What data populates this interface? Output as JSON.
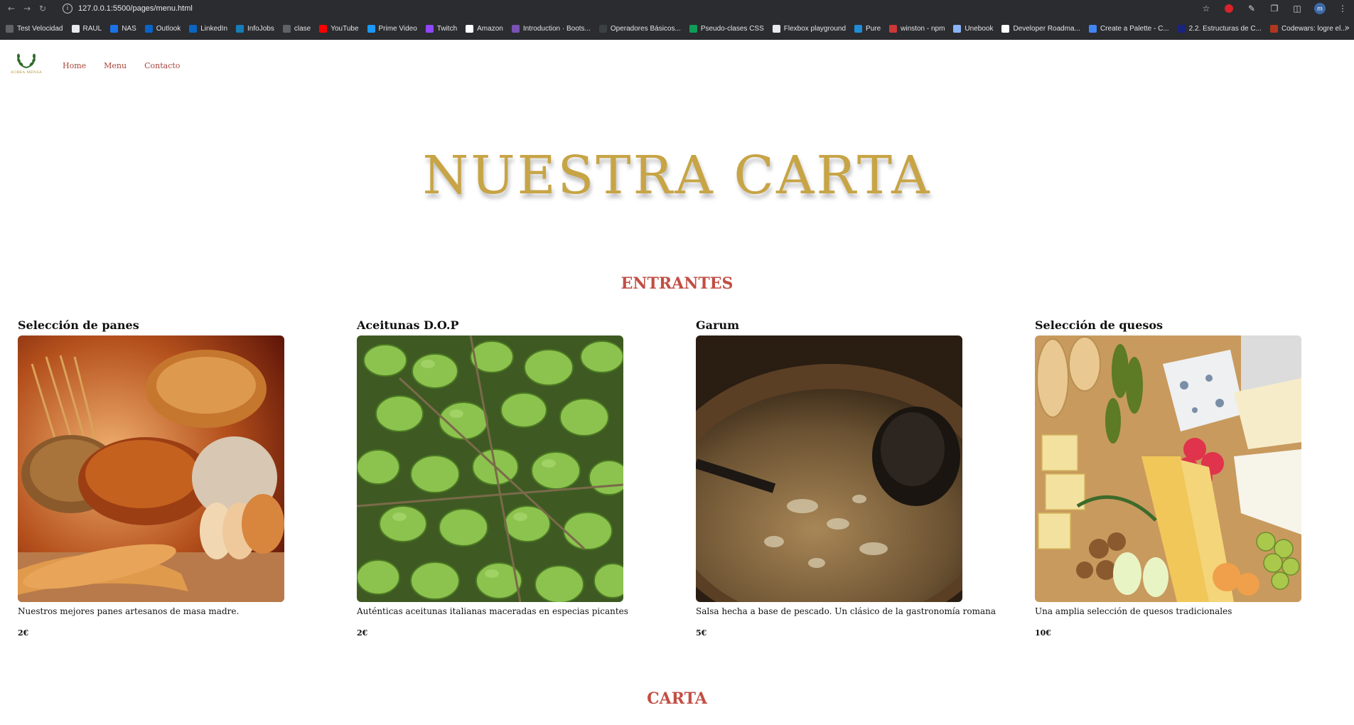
{
  "browser": {
    "url": "127.0.0.1:5500/pages/menu.html",
    "profile_initial": "m",
    "bookmarks": [
      {
        "label": "Test Velocidad",
        "icon": "speed-icon",
        "color": "#5f6368"
      },
      {
        "label": "RAUL",
        "icon": "page-icon",
        "color": "#e8eaed"
      },
      {
        "label": "NAS",
        "icon": "nas-icon",
        "color": "#1a73e8"
      },
      {
        "label": "Outlook",
        "icon": "outlook-icon",
        "color": "#0a64c9"
      },
      {
        "label": "LinkedIn",
        "icon": "linkedin-icon",
        "color": "#0a66c2"
      },
      {
        "label": "InfoJobs",
        "icon": "infojobs-icon",
        "color": "#167db7"
      },
      {
        "label": "clase",
        "icon": "clase-icon",
        "color": "#5f6368"
      },
      {
        "label": "YouTube",
        "icon": "youtube-icon",
        "color": "#ff0000"
      },
      {
        "label": "Prime Video",
        "icon": "prime-video-icon",
        "color": "#1a98ff"
      },
      {
        "label": "Twitch",
        "icon": "twitch-icon",
        "color": "#9146ff"
      },
      {
        "label": "Amazon",
        "icon": "amazon-icon",
        "color": "#ffffff"
      },
      {
        "label": "Introduction · Boots...",
        "icon": "bootstrap-icon",
        "color": "#7952b3"
      },
      {
        "label": "Operadores Básicos...",
        "icon": "operators-icon",
        "color": "#3c4043"
      },
      {
        "label": "Pseudo-clases CSS",
        "icon": "css-icon",
        "color": "#0f9d58"
      },
      {
        "label": "Flexbox playground",
        "icon": "flexbox-icon",
        "color": "#e8eaed"
      },
      {
        "label": "Pure",
        "icon": "pure-icon",
        "color": "#1f8dd6"
      },
      {
        "label": "winston - npm",
        "icon": "npm-icon",
        "color": "#cb3837"
      },
      {
        "label": "Unebook",
        "icon": "unebook-icon",
        "color": "#8ab4f8"
      },
      {
        "label": "Developer Roadma...",
        "icon": "roadmap-icon",
        "color": "#ffffff"
      },
      {
        "label": "Create a Palette - C...",
        "icon": "palette-icon",
        "color": "#4285f4"
      },
      {
        "label": "2.2. Estructuras de C...",
        "icon": "doc-icon",
        "color": "#1a237e"
      },
      {
        "label": "Codewars: logre el...",
        "icon": "codewars-icon",
        "color": "#b1361e"
      }
    ]
  },
  "site": {
    "logo_text": "AUREA MENSA",
    "nav": [
      {
        "label": "Home"
      },
      {
        "label": "Menu"
      },
      {
        "label": "Contacto"
      }
    ],
    "colors": {
      "gold": "#c7a445",
      "accent_red": "#c24e44",
      "nav_link": "#a8433a"
    }
  },
  "hero": {
    "title": "NUESTRA CARTA"
  },
  "sections": {
    "entrantes": "ENTRANTES",
    "carta": "CARTA"
  },
  "items": [
    {
      "title": "Selección de panes",
      "description": "Nuestros mejores panes artesanos de masa madre.",
      "price": "2€"
    },
    {
      "title": "Aceitunas D.O.P",
      "description": "Auténticas aceitunas italianas maceradas en especias picantes",
      "price": "2€"
    },
    {
      "title": "Garum",
      "description": "Salsa hecha a base de pescado. Un clásico de la gastronomía romana",
      "price": "5€"
    },
    {
      "title": "Selección de quesos",
      "description": "Una amplia selección de quesos tradicionales",
      "price": "10€"
    }
  ]
}
